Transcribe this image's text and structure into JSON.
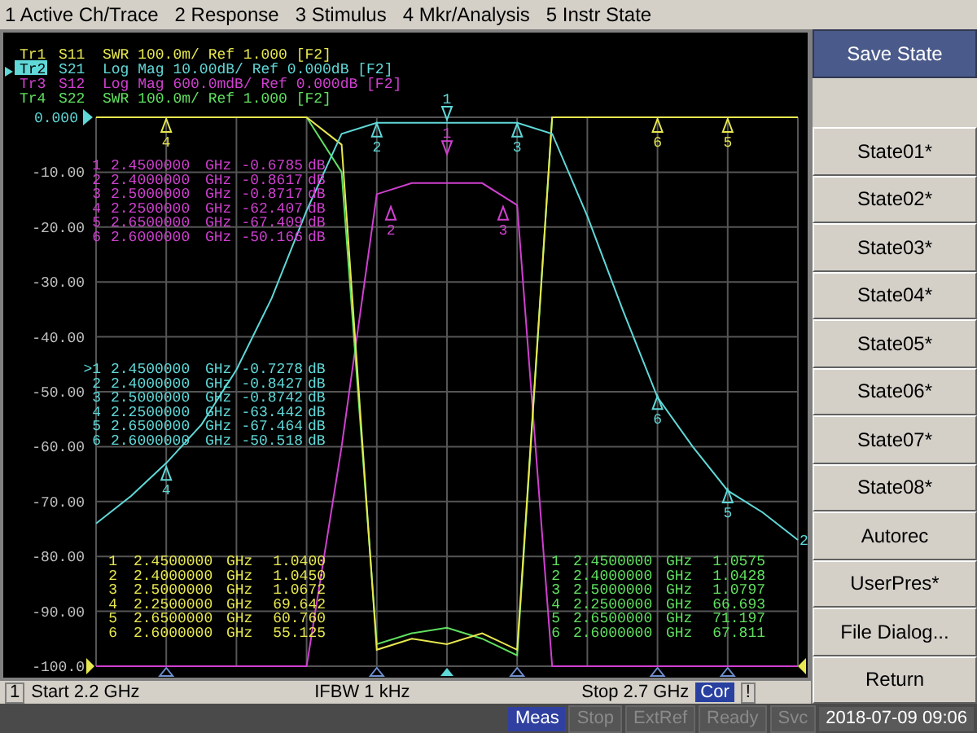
{
  "menu": [
    {
      "label": "1 Active Ch/Trace"
    },
    {
      "label": "2 Response"
    },
    {
      "label": "3 Stimulus"
    },
    {
      "label": "4 Mkr/Analysis"
    },
    {
      "label": "5 Instr State"
    }
  ],
  "traces": [
    {
      "label": "Tr1",
      "text": "S11  SWR 100.0m/ Ref 1.000 [F2]",
      "color": "#e8e850",
      "selected": false
    },
    {
      "label": "Tr2",
      "text": "S21  Log Mag 10.00dB/ Ref 0.000dB [F2]",
      "color": "#60d8d8",
      "selected": true
    },
    {
      "label": "Tr3",
      "text": "S12  Log Mag 600.0mdB/ Ref 0.000dB [F2]",
      "color": "#d040d0",
      "selected": false
    },
    {
      "label": "Tr4",
      "text": "S22  SWR 100.0m/ Ref 1.000 [F2]",
      "color": "#60e060",
      "selected": false
    }
  ],
  "chart": {
    "chart_data": {
      "type": "line",
      "ylim": [
        -100,
        0
      ],
      "grid": true,
      "yticks": [
        {
          "value": 0,
          "label": "0.000"
        },
        {
          "value": -10,
          "label": "-10.00"
        },
        {
          "value": -20,
          "label": "-20.00"
        },
        {
          "value": -30,
          "label": "-30.00"
        },
        {
          "value": -40,
          "label": "-40.00"
        },
        {
          "value": -50,
          "label": "-50.00"
        },
        {
          "value": -60,
          "label": "-60.00"
        },
        {
          "value": -70,
          "label": "-70.00"
        },
        {
          "value": -80,
          "label": "-80.00"
        },
        {
          "value": -90,
          "label": "-90.00"
        },
        {
          "value": -100,
          "label": "-100.0"
        }
      ],
      "categories": [
        null,
        null,
        null,
        null,
        null,
        null,
        null,
        null,
        null,
        null,
        null,
        null,
        null,
        null,
        null,
        null,
        null,
        null,
        null,
        null,
        null
      ],
      "series": [
        {
          "color": "#d040d0",
          "values": [
            -100,
            -100,
            -100,
            -100,
            -100,
            -100,
            -100,
            -60,
            -14,
            -12,
            -12,
            -12,
            -16,
            -100,
            -100,
            -100,
            -100,
            -100,
            -100,
            -100,
            -100
          ]
        },
        {
          "color": "#60e060",
          "values": [
            null,
            null,
            null,
            null,
            null,
            null,
            0,
            -10,
            -96,
            -94,
            -93,
            -95,
            -98,
            0,
            null,
            null,
            null,
            null,
            null,
            null,
            null
          ]
        },
        {
          "color": "#e8e850",
          "values": [
            0,
            0,
            0,
            0,
            0,
            0,
            0,
            -5,
            -97,
            -95,
            -96,
            -94,
            -97,
            0,
            0,
            0,
            0,
            0,
            0,
            0,
            0
          ]
        },
        {
          "color": "#60d8d8",
          "values": [
            -74,
            -69,
            -63,
            -56,
            -46,
            -33,
            -17,
            -3,
            -1,
            -1,
            -1,
            -1,
            -1,
            -3,
            -18,
            -35,
            -51,
            -60,
            -68,
            -72,
            -77
          ]
        }
      ]
    },
    "end_label": "2",
    "markers": [
      {
        "label": "1",
        "color": "#60d8d8"
      },
      {
        "label": "2",
        "color": "#60d8d8"
      },
      {
        "label": "3",
        "color": "#60d8d8"
      },
      {
        "label": "4",
        "color": "#60d8d8"
      },
      {
        "label": "5",
        "color": "#60d8d8"
      },
      {
        "label": "6",
        "color": "#60d8d8"
      },
      {
        "label": "1",
        "color": "#d040d0"
      },
      {
        "label": "2",
        "color": "#d040d0"
      },
      {
        "label": "3",
        "color": "#d040d0"
      },
      {
        "label": "4",
        "color": "#e8e850"
      },
      {
        "label": "6",
        "color": "#e8e850"
      },
      {
        "label": "5",
        "color": "#e8e850"
      }
    ],
    "tables": [
      {
        "color": "#d040d0",
        "rows": [
          [
            "1",
            "2.4500000",
            "GHz",
            "-0.6785",
            "dB"
          ],
          [
            "2",
            "2.4000000",
            "GHz",
            "-0.8617",
            "dB"
          ],
          [
            "3",
            "2.5000000",
            "GHz",
            "-0.8717",
            "dB"
          ],
          [
            "4",
            "2.2500000",
            "GHz",
            "-62.407",
            "dB"
          ],
          [
            "5",
            "2.6500000",
            "GHz",
            "-67.409",
            "dB"
          ],
          [
            "6",
            "2.6000000",
            "GHz",
            "-50.166",
            "dB"
          ]
        ]
      },
      {
        "color": "#60d8d8",
        "rows": [
          [
            ">1",
            "2.4500000",
            "GHz",
            "-0.7278",
            "dB"
          ],
          [
            "2",
            "2.4000000",
            "GHz",
            "-0.8427",
            "dB"
          ],
          [
            "3",
            "2.5000000",
            "GHz",
            "-0.8742",
            "dB"
          ],
          [
            "4",
            "2.2500000",
            "GHz",
            "-63.442",
            "dB"
          ],
          [
            "5",
            "2.6500000",
            "GHz",
            "-67.464",
            "dB"
          ],
          [
            "6",
            "2.6000000",
            "GHz",
            "-50.518",
            "dB"
          ]
        ]
      },
      {
        "color": "#e8e850",
        "rows": [
          [
            "1",
            "2.4500000",
            "GHz",
            "1.0400"
          ],
          [
            "2",
            "2.4000000",
            "GHz",
            "1.0450"
          ],
          [
            "3",
            "2.5000000",
            "GHz",
            "1.0672"
          ],
          [
            "4",
            "2.2500000",
            "GHz",
            "69.642"
          ],
          [
            "5",
            "2.6500000",
            "GHz",
            "60.760"
          ],
          [
            "6",
            "2.6000000",
            "GHz",
            "55.125"
          ]
        ]
      },
      {
        "color": "#60e060",
        "rows": [
          [
            "1",
            "2.4500000",
            "GHz",
            "1.0575"
          ],
          [
            "2",
            "2.4000000",
            "GHz",
            "1.0428"
          ],
          [
            "3",
            "2.5000000",
            "GHz",
            "1.0797"
          ],
          [
            "4",
            "2.2500000",
            "GHz",
            "66.693"
          ],
          [
            "5",
            "2.6500000",
            "GHz",
            "71.197"
          ],
          [
            "6",
            "2.6000000",
            "GHz",
            "67.811"
          ]
        ]
      }
    ]
  },
  "channel_bar": {
    "channel": "1",
    "start": "Start 2.2 GHz",
    "ifbw": "IFBW 1 kHz",
    "stop": "Stop 2.7 GHz",
    "correction": "Cor",
    "warning": "!"
  },
  "softkeys": [
    {
      "label": "Save State",
      "kind": "header"
    },
    {
      "label": "State01*",
      "kind": "key"
    },
    {
      "label": "State02*",
      "kind": "key"
    },
    {
      "label": "State03*",
      "kind": "key"
    },
    {
      "label": "State04*",
      "kind": "key"
    },
    {
      "label": "State05*",
      "kind": "key"
    },
    {
      "label": "State06*",
      "kind": "key"
    },
    {
      "label": "State07*",
      "kind": "key"
    },
    {
      "label": "State08*",
      "kind": "key"
    },
    {
      "label": "Autorec",
      "kind": "key"
    },
    {
      "label": "UserPres*",
      "kind": "key"
    },
    {
      "label": "File Dialog...",
      "kind": "key"
    },
    {
      "label": "Return",
      "kind": "key"
    }
  ],
  "status_bar": {
    "indicators": [
      {
        "label": "Meas",
        "on": true
      },
      {
        "label": "Stop",
        "on": false
      },
      {
        "label": "ExtRef",
        "on": false
      },
      {
        "label": "Ready",
        "on": false
      },
      {
        "label": "Svc",
        "on": false
      }
    ],
    "datetime": "2018-07-09 09:06"
  }
}
